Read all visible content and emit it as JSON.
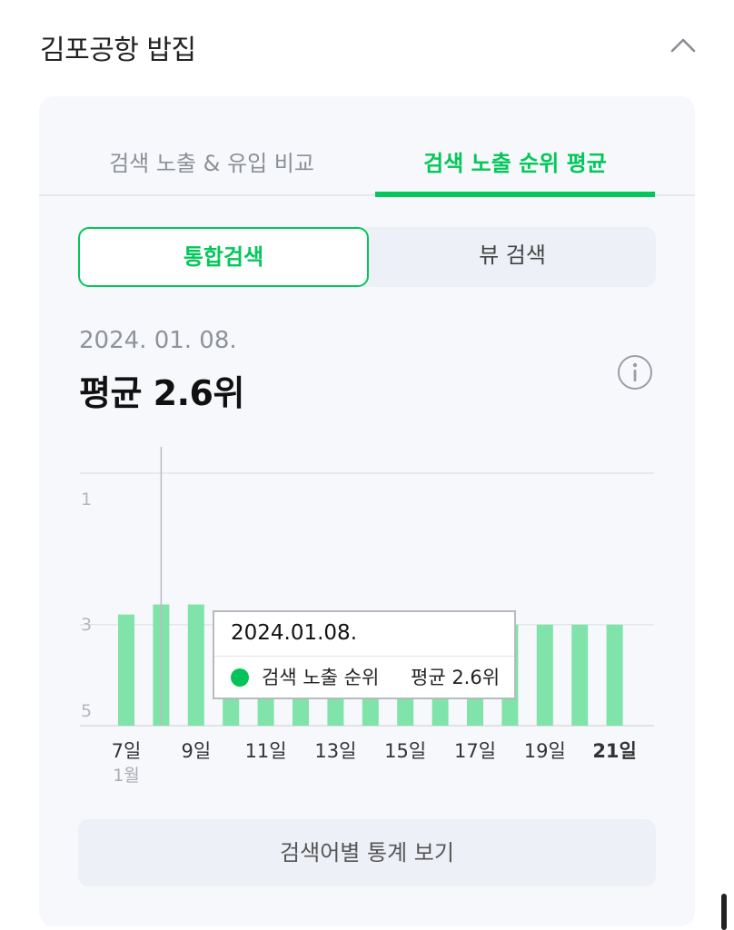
{
  "header": {
    "title": "김포공항 밥집",
    "collapse_icon": "chevron-up-icon"
  },
  "tabs": [
    {
      "label": "검색 노출 & 유입 비교",
      "active": false
    },
    {
      "label": "검색 노출 순위 평균",
      "active": true
    }
  ],
  "segment": [
    {
      "label": "통합검색",
      "active": true
    },
    {
      "label": "뷰 검색",
      "active": false
    }
  ],
  "summary": {
    "date": "2024. 01. 08.",
    "average": "평균 2.6위",
    "info_icon": "info-icon"
  },
  "tooltip": {
    "date": "2024.01.08.",
    "series": "검색 노출 순위",
    "value": "평균 2.6위"
  },
  "colors": {
    "accent": "#03c75a",
    "bar": "#7fe3aa"
  },
  "chart_data": {
    "type": "bar",
    "categories": [
      7,
      8,
      9,
      10,
      11,
      12,
      13,
      14,
      15,
      16,
      17,
      18,
      19,
      20,
      21
    ],
    "series": [
      {
        "values": [
          2.8,
          2.6,
          2.6,
          3,
          3,
          3,
          3,
          3,
          3,
          3,
          3,
          3,
          3,
          3,
          3
        ]
      }
    ],
    "x_ticks": [
      {
        "day": 7,
        "label": "7일",
        "sub": "1월",
        "bold": false
      },
      {
        "day": 9,
        "label": "9일",
        "sub": "",
        "bold": false
      },
      {
        "day": 11,
        "label": "11일",
        "sub": "",
        "bold": false
      },
      {
        "day": 13,
        "label": "13일",
        "sub": "",
        "bold": false
      },
      {
        "day": 15,
        "label": "15일",
        "sub": "",
        "bold": false
      },
      {
        "day": 17,
        "label": "17일",
        "sub": "",
        "bold": false
      },
      {
        "day": 19,
        "label": "19일",
        "sub": "",
        "bold": false
      },
      {
        "day": 21,
        "label": "21일",
        "sub": "",
        "bold": true
      }
    ],
    "y_ticks": [
      1,
      3,
      5
    ],
    "ylim": [
      0,
      5
    ],
    "y_inverted": true,
    "selected_day": 8,
    "grid": true
  },
  "footer": {
    "stats_label": "검색어별 통계 보기"
  }
}
